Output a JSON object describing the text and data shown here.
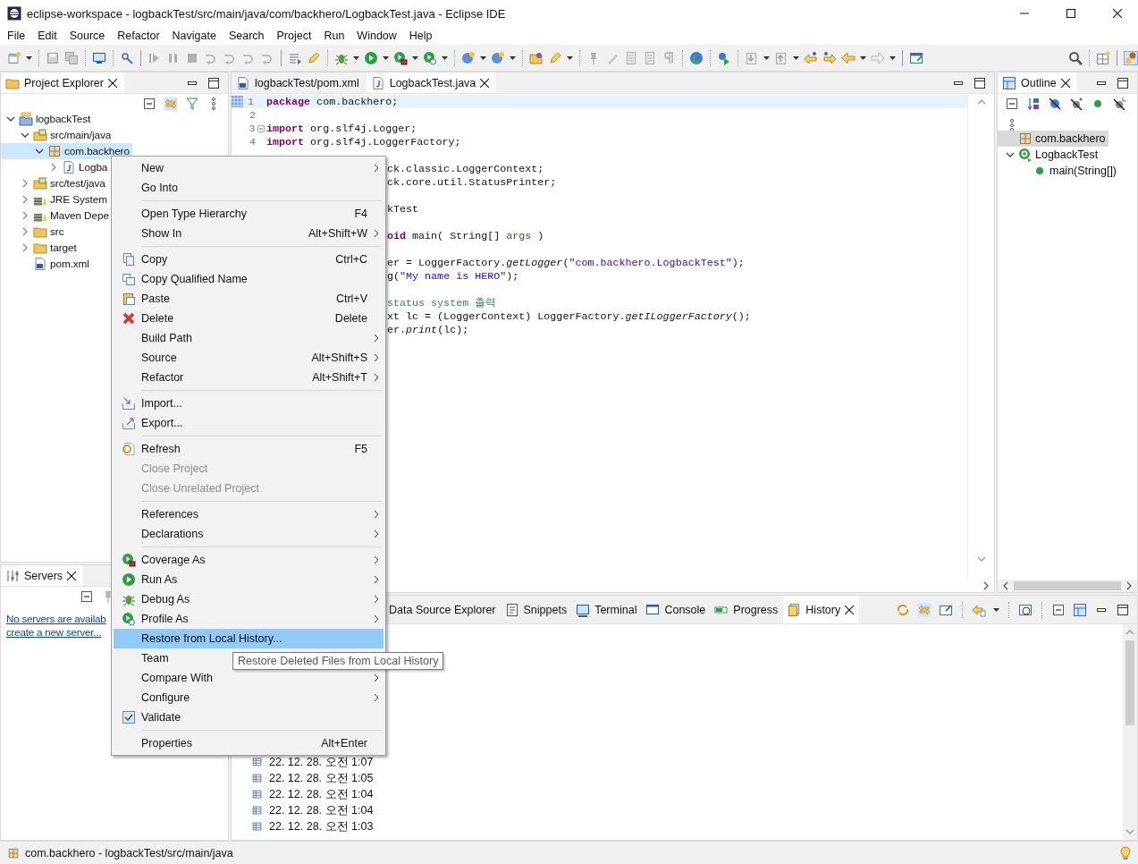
{
  "window": {
    "title": "eclipse-workspace - logbackTest/src/main/java/com/backhero/LogbackTest.java - Eclipse IDE"
  },
  "menu_bar": [
    "File",
    "Edit",
    "Source",
    "Refactor",
    "Navigate",
    "Search",
    "Project",
    "Run",
    "Window",
    "Help"
  ],
  "project_explorer": {
    "title": "Project Explorer",
    "selected": true,
    "tree": [
      {
        "label": "logbackTest",
        "kind": "project",
        "expanded": true,
        "selected": false,
        "children": [
          {
            "label": "src/main/java",
            "kind": "source-folder",
            "expanded": true,
            "selected": false,
            "children": [
              {
                "label": "com.backhero",
                "kind": "package",
                "expanded": true,
                "selected": true,
                "children": [
                  {
                    "label": "Logba",
                    "kind": "java-file",
                    "expanded": false,
                    "selected": false
                  }
                ]
              }
            ]
          },
          {
            "label": "src/test/java",
            "kind": "source-folder",
            "expanded": false,
            "selected": false
          },
          {
            "label": "JRE System",
            "kind": "library",
            "expanded": false,
            "selected": false
          },
          {
            "label": "Maven Depe",
            "kind": "library",
            "expanded": false,
            "selected": false
          },
          {
            "label": "src",
            "kind": "folder",
            "expanded": false,
            "selected": false
          },
          {
            "label": "target",
            "kind": "folder",
            "expanded": false,
            "selected": false
          },
          {
            "label": "pom.xml",
            "kind": "xml-file",
            "selected": false
          }
        ]
      }
    ]
  },
  "servers": {
    "title": "Servers",
    "selected": true,
    "links": [
      "No servers are availab",
      "create a new server..."
    ]
  },
  "editor": {
    "tabs": [
      {
        "label": "logbackTest/pom.xml",
        "kind": "xml",
        "selected": false
      },
      {
        "label": "LogbackTest.java",
        "kind": "java",
        "selected": true
      }
    ],
    "lines": [
      {
        "number": "1",
        "current": true,
        "segments": [
          {
            "kind": "keyword",
            "text": "package"
          },
          {
            "kind": "plain",
            "text": " com.backhero;"
          }
        ]
      },
      {
        "number": "2",
        "current": false
      },
      {
        "number": "3",
        "current": false,
        "fold": true,
        "segments": [
          {
            "kind": "keyword",
            "text": "import"
          },
          {
            "kind": "plain",
            "text": " org.slf4j.Logger;"
          }
        ]
      },
      {
        "number": "4",
        "current": false,
        "segments": [
          {
            "kind": "keyword",
            "text": "import"
          },
          {
            "kind": "plain",
            "text": " org.slf4j.LoggerFactory;"
          }
        ]
      },
      {
        "current": false
      },
      {
        "current": false,
        "segments": [
          {
            "kind": "plain",
            "text": "ck.classic.LoggerContext;"
          }
        ]
      },
      {
        "current": false,
        "segments": [
          {
            "kind": "plain",
            "text": "ck.core.util.StatusPrinter;"
          }
        ]
      },
      {
        "current": false
      },
      {
        "current": false,
        "segments": [
          {
            "kind": "plain",
            "text": "kTest"
          }
        ]
      },
      {
        "current": false
      },
      {
        "current": false,
        "segments": [
          {
            "kind": "keyword",
            "text": "oid"
          },
          {
            "kind": "plain",
            "text": " main( String[] "
          },
          {
            "kind": "variable",
            "text": "args"
          },
          {
            "kind": "plain",
            "text": " )"
          }
        ]
      },
      {
        "current": false
      },
      {
        "current": false,
        "segments": [
          {
            "kind": "plain",
            "text": "er = LoggerFactory."
          },
          {
            "kind": "italic",
            "text": "getLogger"
          },
          {
            "kind": "plain",
            "text": "("
          },
          {
            "kind": "string",
            "text": "\"com.backhero.LogbackTest\""
          },
          {
            "kind": "plain",
            "text": ");"
          }
        ]
      },
      {
        "current": false,
        "segments": [
          {
            "kind": "plain",
            "text": "g("
          },
          {
            "kind": "string",
            "text": "\"My name is HERO\""
          },
          {
            "kind": "plain",
            "text": ");"
          }
        ]
      },
      {
        "current": false
      },
      {
        "current": false,
        "segments": [
          {
            "kind": "comment",
            "text": "status system 출력"
          }
        ]
      },
      {
        "current": false,
        "segments": [
          {
            "kind": "plain",
            "text": "xt lc = (LoggerContext) LoggerFactory."
          },
          {
            "kind": "italic",
            "text": "getILoggerFactory"
          },
          {
            "kind": "plain",
            "text": "();"
          }
        ]
      },
      {
        "current": false,
        "segments": [
          {
            "kind": "plain",
            "text": "er."
          },
          {
            "kind": "italic",
            "text": "print"
          },
          {
            "kind": "plain",
            "text": "(lc);"
          }
        ]
      }
    ]
  },
  "outline": {
    "title": "Outline",
    "selected": true,
    "tree": [
      {
        "label": "com.backhero",
        "kind": "package",
        "selected": true
      },
      {
        "label": "LogbackTest",
        "kind": "class",
        "expanded": true,
        "selected": false,
        "children": [
          {
            "label": "main(String[])",
            "kind": "method",
            "selected": false
          }
        ]
      }
    ]
  },
  "bottom_panel": {
    "tabs": [
      {
        "label": "Data Source Explorer",
        "kind": "datasource",
        "selected": false
      },
      {
        "label": "Snippets",
        "kind": "snippets",
        "selected": false
      },
      {
        "label": "Terminal",
        "kind": "terminal",
        "selected": false
      },
      {
        "label": "Console",
        "kind": "console",
        "selected": false
      },
      {
        "label": "Progress",
        "kind": "progress",
        "selected": false
      },
      {
        "label": "History",
        "kind": "history",
        "selected": true
      }
    ],
    "history": [
      "22. 12. 28. 오전 1:07",
      "22. 12. 28. 오전 1:05",
      "22. 12. 28. 오전 1:04",
      "22. 12. 28. 오전 1:04",
      "22. 12. 28. 오전 1:03"
    ]
  },
  "context_menu": {
    "items": [
      {
        "kind": "item",
        "label": "New",
        "submenu": true,
        "disabled": false,
        "selected": false,
        "checked": false
      },
      {
        "kind": "item",
        "label": "Go Into",
        "submenu": false,
        "disabled": false,
        "selected": false,
        "checked": false
      },
      {
        "kind": "separator"
      },
      {
        "kind": "item",
        "label": "Open Type Hierarchy",
        "shortcut": "F4",
        "submenu": false,
        "disabled": false,
        "selected": false,
        "checked": false
      },
      {
        "kind": "item",
        "label": "Show In",
        "shortcut": "Alt+Shift+W",
        "submenu": true,
        "disabled": false,
        "selected": false,
        "checked": false
      },
      {
        "kind": "separator"
      },
      {
        "kind": "item",
        "label": "Copy",
        "shortcut": "Ctrl+C",
        "submenu": false,
        "disabled": false,
        "selected": false,
        "checked": false
      },
      {
        "kind": "item",
        "label": "Copy Qualified Name",
        "submenu": false,
        "disabled": false,
        "selected": false,
        "checked": false
      },
      {
        "kind": "item",
        "label": "Paste",
        "shortcut": "Ctrl+V",
        "submenu": false,
        "disabled": false,
        "selected": false,
        "checked": false
      },
      {
        "kind": "item",
        "label": "Delete",
        "shortcut": "Delete",
        "submenu": false,
        "disabled": false,
        "selected": false,
        "checked": false
      },
      {
        "kind": "item",
        "label": "Build Path",
        "submenu": true,
        "disabled": false,
        "selected": false,
        "checked": false
      },
      {
        "kind": "item",
        "label": "Source",
        "shortcut": "Alt+Shift+S",
        "submenu": true,
        "disabled": false,
        "selected": false,
        "checked": false
      },
      {
        "kind": "item",
        "label": "Refactor",
        "shortcut": "Alt+Shift+T",
        "submenu": true,
        "disabled": false,
        "selected": false,
        "checked": false
      },
      {
        "kind": "separator"
      },
      {
        "kind": "item",
        "label": "Import...",
        "submenu": false,
        "disabled": false,
        "selected": false,
        "checked": false
      },
      {
        "kind": "item",
        "label": "Export...",
        "submenu": false,
        "disabled": false,
        "selected": false,
        "checked": false
      },
      {
        "kind": "separator"
      },
      {
        "kind": "item",
        "label": "Refresh",
        "shortcut": "F5",
        "submenu": false,
        "disabled": false,
        "selected": false,
        "checked": false
      },
      {
        "kind": "item",
        "label": "Close Project",
        "submenu": false,
        "disabled": true,
        "selected": false,
        "checked": false
      },
      {
        "kind": "item",
        "label": "Close Unrelated Project",
        "submenu": false,
        "disabled": true,
        "selected": false,
        "checked": false
      },
      {
        "kind": "separator"
      },
      {
        "kind": "item",
        "label": "References",
        "submenu": true,
        "disabled": false,
        "selected": false,
        "checked": false
      },
      {
        "kind": "item",
        "label": "Declarations",
        "submenu": true,
        "disabled": false,
        "selected": false,
        "checked": false
      },
      {
        "kind": "separator"
      },
      {
        "kind": "item",
        "label": "Coverage As",
        "submenu": true,
        "disabled": false,
        "selected": false,
        "checked": false
      },
      {
        "kind": "item",
        "label": "Run As",
        "submenu": true,
        "disabled": false,
        "selected": false,
        "checked": false
      },
      {
        "kind": "item",
        "label": "Debug As",
        "submenu": true,
        "disabled": false,
        "selected": false,
        "checked": false
      },
      {
        "kind": "item",
        "label": "Profile As",
        "submenu": true,
        "disabled": false,
        "selected": false,
        "checked": false
      },
      {
        "kind": "item",
        "label": "Restore from Local History...",
        "submenu": false,
        "disabled": false,
        "selected": true,
        "checked": false
      },
      {
        "kind": "item",
        "label": "Team",
        "submenu": false,
        "disabled": false,
        "selected": false,
        "checked": false
      },
      {
        "kind": "item",
        "label": "Compare With",
        "submenu": true,
        "disabled": false,
        "selected": false,
        "checked": false
      },
      {
        "kind": "item",
        "label": "Configure",
        "submenu": true,
        "disabled": false,
        "selected": false,
        "checked": false
      },
      {
        "kind": "item",
        "label": "Validate",
        "submenu": false,
        "disabled": false,
        "selected": false,
        "checked": true
      },
      {
        "kind": "separator"
      },
      {
        "kind": "item",
        "label": "Properties",
        "shortcut": "Alt+Enter",
        "submenu": false,
        "disabled": false,
        "selected": false,
        "checked": false
      }
    ]
  },
  "tooltip": {
    "text": "Restore Deleted Files from Local History"
  },
  "status_bar": {
    "text": "com.backhero - logbackTest/src/main/java"
  }
}
